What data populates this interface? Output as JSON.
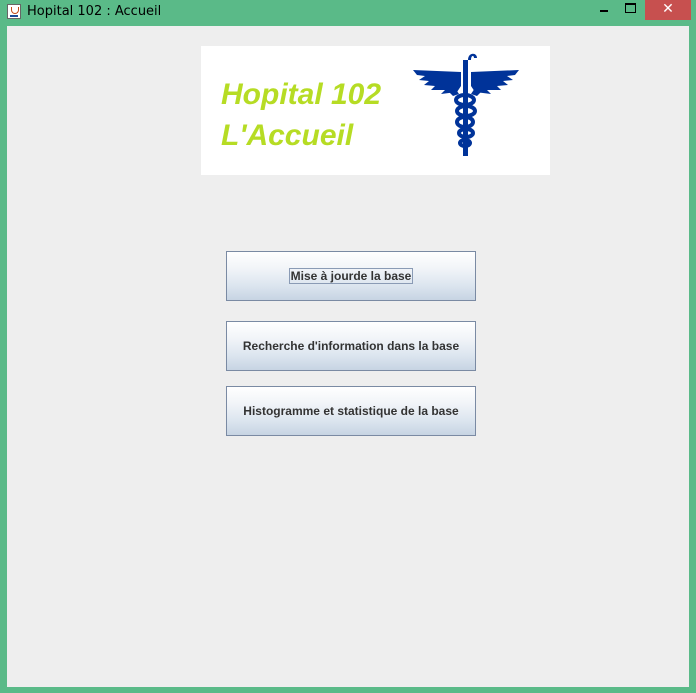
{
  "window": {
    "title": "Hopital 102 : Accueil",
    "close_glyph": "✕",
    "icons": [
      "java-app-icon",
      "minimize-icon",
      "maximize-icon",
      "close-icon"
    ]
  },
  "banner": {
    "line1": "Hopital 102",
    "line2": "L'Accueil",
    "logo": "caduceus-icon",
    "text_color": "#b6dc24",
    "logo_color": "#003399"
  },
  "buttons": {
    "update_label": "Mise à jourde la base",
    "search_label": "Recherche d'information dans la base",
    "histogram_label": "Histogramme et statistique de la base"
  },
  "colors": {
    "titlebar": "#5aba88",
    "close": "#c7504f",
    "client": "#eeeeee"
  }
}
